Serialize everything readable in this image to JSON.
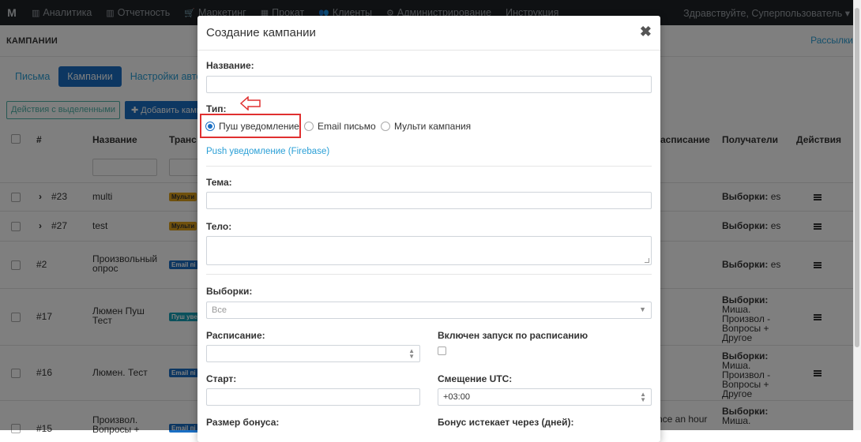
{
  "topbar": {
    "logo": "M",
    "nav": [
      {
        "icon": "chart-icon",
        "glyph": "▥",
        "label": "Аналитика"
      },
      {
        "icon": "report-icon",
        "glyph": "▥",
        "label": "Отчетность"
      },
      {
        "icon": "cart-icon",
        "glyph": "🛒",
        "label": "Маркетинг"
      },
      {
        "icon": "box-icon",
        "glyph": "▦",
        "label": "Прокат"
      },
      {
        "icon": "users-icon",
        "glyph": "👥",
        "label": "Клиенты"
      },
      {
        "icon": "gear-icon",
        "glyph": "⚙",
        "label": "Администрирование"
      },
      {
        "icon": "book-icon",
        "glyph": "",
        "label": "Инструкция"
      }
    ],
    "greeting": "Здравствуйте, Суперпользователь ▾"
  },
  "page": {
    "title": "КАМПАНИИ",
    "mailings_link": "Рассылки"
  },
  "tabs": [
    {
      "label": "Письма",
      "active": false
    },
    {
      "label": "Кампании",
      "active": true
    },
    {
      "label": "Настройки авто к",
      "active": false
    }
  ],
  "actions": {
    "bulk": "Действия с выделенными",
    "add": "✚ Добавить кампани"
  },
  "table": {
    "headers": {
      "num": "#",
      "name": "Название",
      "trans": "Транс",
      "schedule": "асписание",
      "recipients": "Получатели",
      "actions": "Действия"
    },
    "rows": [
      {
        "expand": "›",
        "id": "#23",
        "name": "multi",
        "badge": "Мульти",
        "badge_type": "multi",
        "schedule": "",
        "recipients_bold": "Выборки:",
        "recipients": "es"
      },
      {
        "expand": "›",
        "id": "#27",
        "name": "test",
        "badge": "Мульти",
        "badge_type": "multi",
        "schedule": "",
        "recipients_bold": "Выборки:",
        "recipients": "es"
      },
      {
        "expand": "",
        "id": "#2",
        "name": "Произвольный опрос",
        "badge": "Email пі",
        "badge_type": "email",
        "schedule": "",
        "recipients_bold": "Выборки:",
        "recipients": "es"
      },
      {
        "expand": "",
        "id": "#17",
        "name": "Люмен Пуш Тест",
        "badge": "Пуш уве",
        "badge_type": "push",
        "schedule": "",
        "recipients_bold": "Выборки:",
        "recipients": "Миша. Произвол - Вопросы + Другое"
      },
      {
        "expand": "",
        "id": "#16",
        "name": "Люмен. Тест",
        "badge": "Email пі",
        "badge_type": "email",
        "schedule": "",
        "recipients_bold": "Выборки:",
        "recipients": "Миша. Произвол - Вопросы + Другое"
      },
      {
        "expand": "",
        "id": "#15",
        "name": "Произвол. Вопросы +",
        "badge": "Email пі",
        "badge_type": "email",
        "schedule": "nce an hour",
        "recipients_bold": "Выборки:",
        "recipients": "Миша."
      }
    ]
  },
  "modal": {
    "title": "Создание кампании",
    "close": "✖",
    "name_label": "Название:",
    "name_value": "",
    "type_label": "Тип:",
    "type_options": [
      {
        "label": "Пуш уведомление",
        "checked": true
      },
      {
        "label": "Email письмо",
        "checked": false
      },
      {
        "label": "Мульти кампания",
        "checked": false
      }
    ],
    "push_link": "Push уведомление (Firebase)",
    "subject_label": "Тема:",
    "body_label": "Тело:",
    "selections_label": "Выборки:",
    "selections_placeholder": "Все",
    "schedule_label": "Расписание:",
    "schedule_enabled_label": "Включен запуск по расписанию",
    "start_label": "Старт:",
    "utc_label": "Смещение UTC:",
    "utc_value": "+03:00",
    "bonus_label": "Размер бонуса:",
    "bonus_expire_label": "Бонус истекает через (дней):"
  },
  "colors": {
    "primary": "#1a6fc4",
    "link": "#2a9fd6",
    "annotation": "#e03030",
    "topbar": "#1f2226"
  }
}
